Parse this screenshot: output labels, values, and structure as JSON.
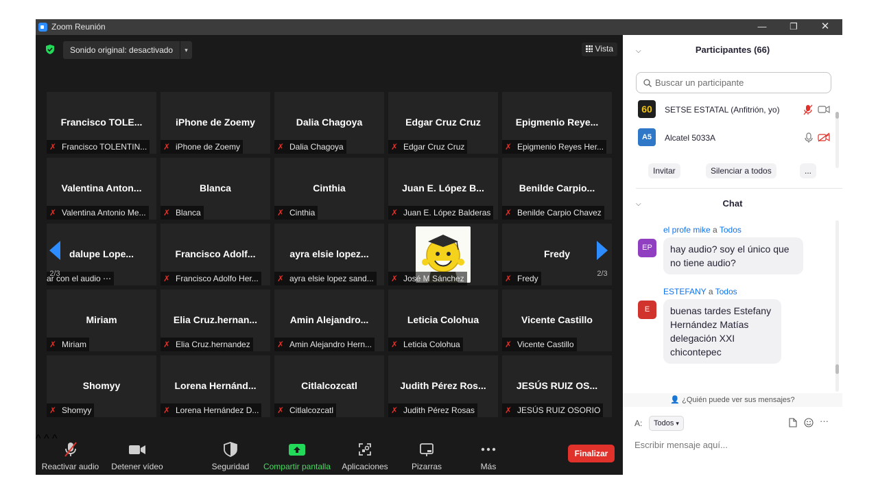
{
  "window": {
    "title": "Zoom Reunión",
    "minimize": "—",
    "restore": "❐",
    "close": "✕"
  },
  "topbar": {
    "sound_label": "Sonido original: desactivado",
    "sound_arrow": "▾",
    "view_label": "Vista"
  },
  "tiles": [
    {
      "big": "Francisco  TOLE...",
      "tag": "Francisco TOLENTIN..."
    },
    {
      "big": "iPhone de Zoemy",
      "tag": "iPhone de Zoemy"
    },
    {
      "big": "Dalia Chagoya",
      "tag": "Dalia Chagoya"
    },
    {
      "big": "Edgar Cruz Cruz",
      "tag": "Edgar Cruz Cruz"
    },
    {
      "big": "Epigmenio  Reye...",
      "tag": "Epigmenio Reyes Her..."
    },
    {
      "big": "Valentina  Anton...",
      "tag": "Valentina Antonio Me..."
    },
    {
      "big": "Blanca",
      "tag": "Blanca"
    },
    {
      "big": "Cinthia",
      "tag": "Cinthia"
    },
    {
      "big": "Juan E. López B...",
      "tag": "Juan E. López Balderas"
    },
    {
      "big": "Benilde  Carpio...",
      "tag": "Benilde Carpio Chavez"
    },
    {
      "big": "dalupe  Lope...",
      "tag": "ar con el audio ⋯"
    },
    {
      "big": "Francisco  Adolf...",
      "tag": "Francisco Adolfo Her..."
    },
    {
      "big": "ayra  elsie  lopez...",
      "tag": "ayra elsie lopez sand..."
    },
    {
      "big": "",
      "tag": "José M Sánchez"
    },
    {
      "big": "Fredy",
      "tag": "Fredy"
    },
    {
      "big": "Miriam",
      "tag": "Miriam"
    },
    {
      "big": "Elia  Cruz.hernan...",
      "tag": "Elia Cruz.hernandez"
    },
    {
      "big": "Amin  Alejandro...",
      "tag": "Amin Alejandro Hern..."
    },
    {
      "big": "Leticia Colohua",
      "tag": "Leticia Colohua"
    },
    {
      "big": "Vicente Castillo",
      "tag": "Vicente Castillo"
    },
    {
      "big": "Shomyy",
      "tag": "Shomyy"
    },
    {
      "big": "Lorena  Hernánd...",
      "tag": "Lorena Hernández D..."
    },
    {
      "big": "Citlalcozcatl",
      "tag": "Citlalcozcatl"
    },
    {
      "big": "Judith Pérez Ros...",
      "tag": "Judith Pérez Rosas"
    },
    {
      "big": "JESÚS RUIZ OS...",
      "tag": "JESÚS RUIZ OSORIO"
    }
  ],
  "pager": {
    "left": "2/3",
    "right": "2/3"
  },
  "toolbar": {
    "unmute": "Reactivar audio",
    "stop_video": "Detener vídeo",
    "security": "Seguridad",
    "share": "Compartir pantalla",
    "apps": "Aplicaciones",
    "whiteboards": "Pizarras",
    "more": "Más",
    "end": "Finalizar",
    "caret": "^"
  },
  "participants": {
    "title": "Participantes (66)",
    "search_placeholder": "Buscar un participante",
    "list": [
      {
        "avatar": "60",
        "name": "SETSE ESTATAL (Anfitrión, yo)"
      },
      {
        "avatar": "A5",
        "name": "Alcatel 5033A"
      }
    ],
    "invite": "Invitar",
    "mute_all": "Silenciar a todos",
    "more": "..."
  },
  "chat": {
    "title": "Chat",
    "messages": [
      {
        "from": "el profe mike",
        "to_word": "a",
        "to": "Todos",
        "avatar": "EP",
        "text": "hay audio? soy el único que no tiene audio?"
      },
      {
        "from": "ESTEFANY",
        "to_word": "a",
        "to": "Todos",
        "avatar": "E",
        "text": "buenas tardes Estefany Hernández Matías delegación XXI chicontepec"
      }
    ],
    "who_can_see": "¿Quién puede ver sus mensajes?",
    "to_label": "A:",
    "recipient": "Todos",
    "input_placeholder": "Escribir mensaje aquí...",
    "more": "···"
  },
  "colors": {
    "accent": "#2d8cff",
    "muted_red": "#e0312b",
    "share_green": "#4cd964",
    "ep_avatar": "#8f3fbf",
    "e_avatar": "#d0342c"
  }
}
